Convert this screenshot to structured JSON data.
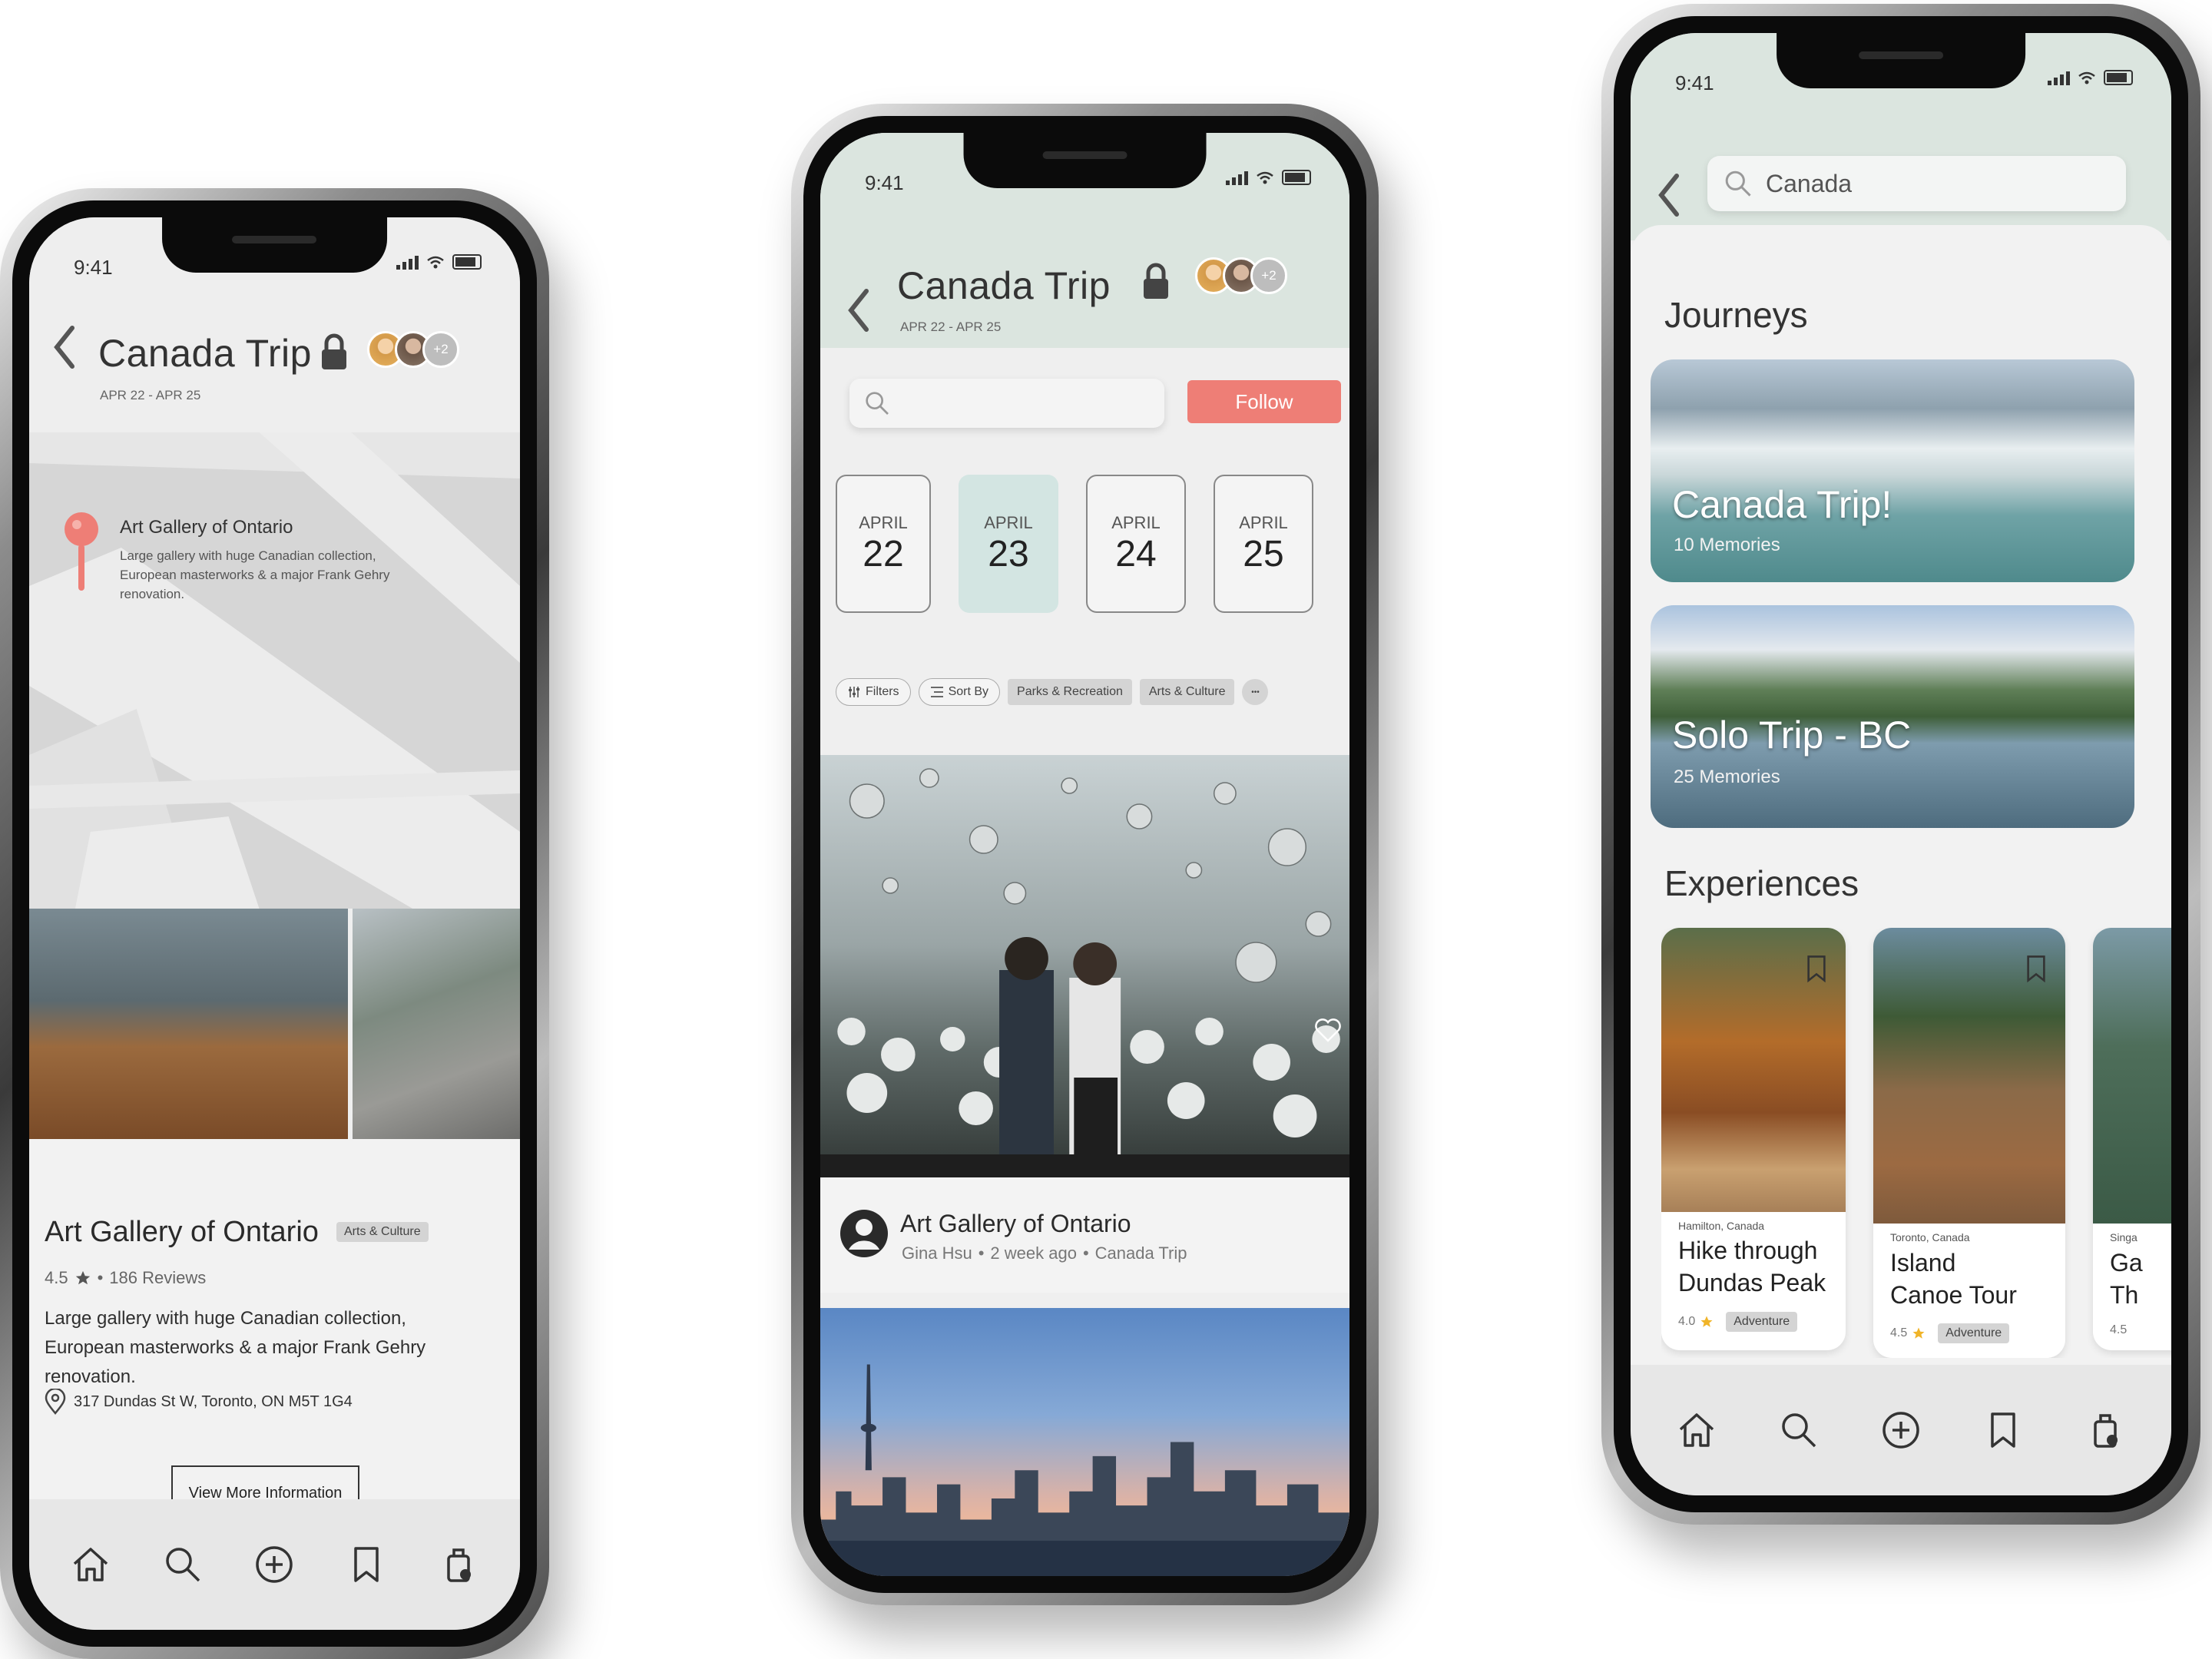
{
  "status": {
    "time": "9:41"
  },
  "trip": {
    "title": "Canada Trip",
    "dates": "APR 22 - APR 25",
    "extra_members": "+2"
  },
  "map_screen": {
    "pin": {
      "name": "Art Gallery of Ontario",
      "desc": "Large gallery with huge Canadian collection, European masterworks & a major Frank Gehry renovation."
    },
    "place": {
      "name": "Art Gallery of Ontario",
      "tag": "Arts & Culture",
      "rating": "4.5",
      "reviews": "186 Reviews",
      "desc": "Large gallery with huge Canadian collection, European masterworks & a major Frank Gehry renovation.",
      "address": "317 Dundas St W, Toronto, ON M5T 1G4",
      "button": "View More Information"
    }
  },
  "feed_screen": {
    "follow_label": "Follow",
    "dates": [
      {
        "month": "APRIL",
        "day": "22"
      },
      {
        "month": "APRIL",
        "day": "23"
      },
      {
        "month": "APRIL",
        "day": "24"
      },
      {
        "month": "APRIL",
        "day": "25"
      }
    ],
    "chips": {
      "filters": "Filters",
      "sort": "Sort By",
      "parks": "Parks & Recreation",
      "arts": "Arts & Culture",
      "more": "•••"
    },
    "post": {
      "title": "Art Gallery of Ontario",
      "author": "Gina Hsu",
      "time": "2 week ago",
      "trip": "Canada Trip",
      "sep": "•"
    }
  },
  "search_screen": {
    "query": "Canada",
    "journeys_heading": "Journeys",
    "journeys": [
      {
        "title": "Canada Trip!",
        "count": "10 Memories"
      },
      {
        "title": "Solo Trip - BC",
        "count": "25 Memories"
      }
    ],
    "experiences_heading": "Experiences",
    "experiences": [
      {
        "location": "Hamilton, Canada",
        "title1": "Hike through",
        "title2": "Dundas Peak",
        "rating": "4.0",
        "tag": "Adventure"
      },
      {
        "location": "Toronto, Canada",
        "title1": "Island",
        "title2": "Canoe Tour",
        "rating": "4.5",
        "tag": "Adventure"
      },
      {
        "location": "Singa",
        "title1": "Ga",
        "title2": "Th",
        "rating": "4.5"
      }
    ]
  },
  "colors": {
    "accent_mint": "#dbe5df",
    "selected_date": "#d3e5e2",
    "follow": "#ee7e76",
    "tag_gray": "#d4d4d4",
    "star": "#f0b429"
  },
  "icons": [
    "back-chevron-icon",
    "lock-icon",
    "pin-icon",
    "star-icon",
    "location-icon",
    "search-icon",
    "filter-icon",
    "sort-icon",
    "user-icon",
    "heart-icon",
    "bookmark-icon",
    "home-icon",
    "plus-circle-icon",
    "luggage-icon"
  ]
}
